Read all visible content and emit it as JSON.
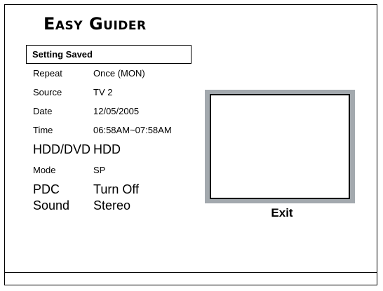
{
  "title": "Easy Guider",
  "status": "Setting Saved",
  "settings": [
    {
      "label": "Repeat",
      "value": "Once (MON)"
    },
    {
      "label": "Source",
      "value": "TV  2"
    },
    {
      "label": "Date",
      "value": "12/05/2005"
    },
    {
      "label": "Time",
      "value": "06:58AM~07:58AM"
    },
    {
      "label": "HDD/DVD",
      "value": "HDD"
    },
    {
      "label": "Mode",
      "value": "SP"
    },
    {
      "label": "PDC",
      "value": "Turn Off"
    },
    {
      "label": "Sound",
      "value": "Stereo"
    }
  ],
  "exit_label": "Exit",
  "colors": {
    "preview_frame": "#a3a9ae"
  }
}
